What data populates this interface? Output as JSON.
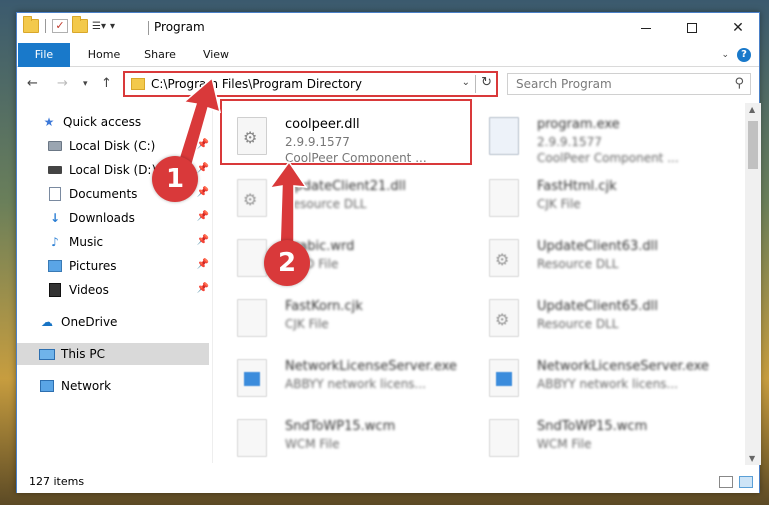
{
  "window": {
    "title": "Program",
    "minimize": "minimize",
    "maximize": "maximize",
    "close": "close"
  },
  "ribbon": {
    "tabs": [
      "File",
      "Home",
      "Share",
      "View"
    ]
  },
  "address": {
    "path": "C:\\Program Files\\Program Directory"
  },
  "search": {
    "placeholder": "Search Program"
  },
  "sidebar": {
    "items": [
      {
        "label": "Quick access",
        "icon": "star-icon"
      },
      {
        "label": "Local Disk (C:)",
        "icon": "disk-icon",
        "pinned": true
      },
      {
        "label": "Local Disk (D:)",
        "icon": "disk-icon",
        "pinned": true
      },
      {
        "label": "Documents",
        "icon": "documents-icon",
        "pinned": true
      },
      {
        "label": "Downloads",
        "icon": "downloads-icon",
        "pinned": true
      },
      {
        "label": "Music",
        "icon": "music-icon",
        "pinned": true
      },
      {
        "label": "Pictures",
        "icon": "pictures-icon",
        "pinned": true
      },
      {
        "label": "Videos",
        "icon": "videos-icon",
        "pinned": true
      },
      {
        "label": "OneDrive",
        "icon": "cloud-icon"
      },
      {
        "label": "This PC",
        "icon": "computer-icon",
        "selected": true
      },
      {
        "label": "Network",
        "icon": "network-icon"
      }
    ]
  },
  "files": [
    {
      "name": "coolpeer.dll",
      "line1": "2.9.9.1577",
      "line2": "CoolPeer Component ...",
      "icon": "dll-gear-icon"
    },
    {
      "name": "program.exe",
      "line1": "2.9.9.1577",
      "line2": "CoolPeer Component ...",
      "icon": "exe-icon"
    },
    {
      "name": "UpdateClient21.dll",
      "line1": "Resource DLL",
      "line2": "",
      "icon": "dll-gear-icon"
    },
    {
      "name": "FastHtml.cjk",
      "line1": "CJK File",
      "line2": "",
      "icon": "file-icon"
    },
    {
      "name": "Arabic.wrd",
      "line1": "WRD File",
      "line2": "",
      "icon": "file-icon"
    },
    {
      "name": "UpdateClient63.dll",
      "line1": "Resource DLL",
      "line2": "",
      "icon": "dll-gear-icon"
    },
    {
      "name": "FastKorn.cjk",
      "line1": "CJK File",
      "line2": "",
      "icon": "file-icon"
    },
    {
      "name": "UpdateClient65.dll",
      "line1": "Resource DLL",
      "line2": "",
      "icon": "dll-gear-icon"
    },
    {
      "name": "NetworkLicenseServer.exe",
      "line1": "ABBYY network licens...",
      "line2": "",
      "icon": "app-window-icon"
    },
    {
      "name": "NetworkLicenseServer.exe",
      "line1": "ABBYY network licens...",
      "line2": "",
      "icon": "app-window-icon"
    },
    {
      "name": "SndToWP15.wcm",
      "line1": "WCM File",
      "line2": "",
      "icon": "file-icon"
    },
    {
      "name": "SndToWP15.wcm",
      "line1": "WCM File",
      "line2": "",
      "icon": "file-icon"
    }
  ],
  "status": {
    "item_count": "127 items"
  },
  "callouts": [
    "1",
    "2"
  ],
  "colors": {
    "accent": "#1979ca",
    "highlight": "#d9393a"
  }
}
